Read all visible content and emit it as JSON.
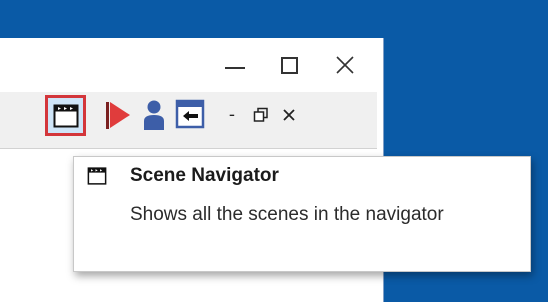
{
  "window": {
    "minimize_symbol": "—",
    "maximize_symbol": "☐",
    "close_symbol": "✕"
  },
  "toolbar": {
    "icons": [
      "scene-navigator-icon",
      "play-icon",
      "person-icon",
      "dock-icon"
    ],
    "dash_symbol": "-",
    "restore_symbol": "🗗",
    "close_symbol": "×"
  },
  "tooltip": {
    "title": "Scene Navigator",
    "description": "Shows all the scenes in the navigator"
  },
  "colors": {
    "desktop": "#0a5aa6",
    "highlight_border": "#d3363b",
    "play": "#e03c3c",
    "person": "#3d5ea8",
    "dock": "#3d5ea8"
  }
}
